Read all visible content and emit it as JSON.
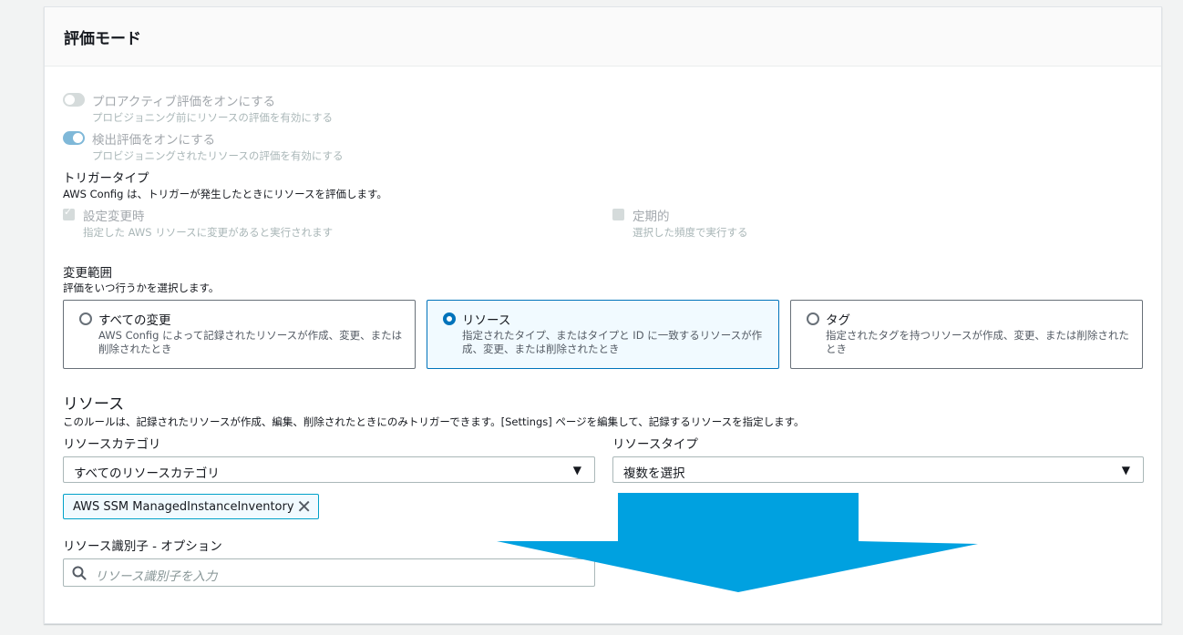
{
  "panel": {
    "title": "評価モード"
  },
  "proactive": {
    "label": "プロアクティブ評価をオンにする",
    "description": "プロビジョニング前にリソースの評価を有効にする",
    "enabled": false
  },
  "detective": {
    "label": "検出評価をオンにする",
    "description": "プロビジョニングされたリソースの評価を有効にする",
    "enabled": true
  },
  "trigger": {
    "title": "トリガータイプ",
    "description": "AWS Config は、トリガーが発生したときにリソースを評価します。",
    "config_change": {
      "label": "設定変更時",
      "description": "指定した AWS リソースに変更があると実行されます",
      "checked": true
    },
    "periodic": {
      "label": "定期的",
      "description": "選択した頻度で実行する",
      "checked": false
    }
  },
  "scope": {
    "title": "変更範囲",
    "description": "評価をいつ行うかを選択します。",
    "options": [
      {
        "label": "すべての変更",
        "description": "AWS Config によって記録されたリソースが作成、変更、または削除されたとき",
        "selected": false
      },
      {
        "label": "リソース",
        "description": "指定されたタイプ、またはタイプと ID に一致するリソースが作成、変更、または削除されたとき",
        "selected": true
      },
      {
        "label": "タグ",
        "description": "指定されたタグを持つリソースが作成、変更、または削除されたとき",
        "selected": false
      }
    ]
  },
  "resources": {
    "title": "リソース",
    "description": "このルールは、記録されたリソースが作成、編集、削除されたときにのみトリガーできます。[Settings] ページを編集して、記録するリソースを指定します。",
    "category_label": "リソースカテゴリ",
    "category_value": "すべてのリソースカテゴリ",
    "type_label": "リソースタイプ",
    "type_value": "複数を選択",
    "selected_token": "AWS SSM ManagedInstanceInventory",
    "identifier_label": "リソース識別子 - オプション",
    "identifier_placeholder": "リソース識別子を入力"
  },
  "colors": {
    "accent": "#0073bb",
    "arrow": "#00a1e0",
    "token_border": "#00a1c9"
  }
}
